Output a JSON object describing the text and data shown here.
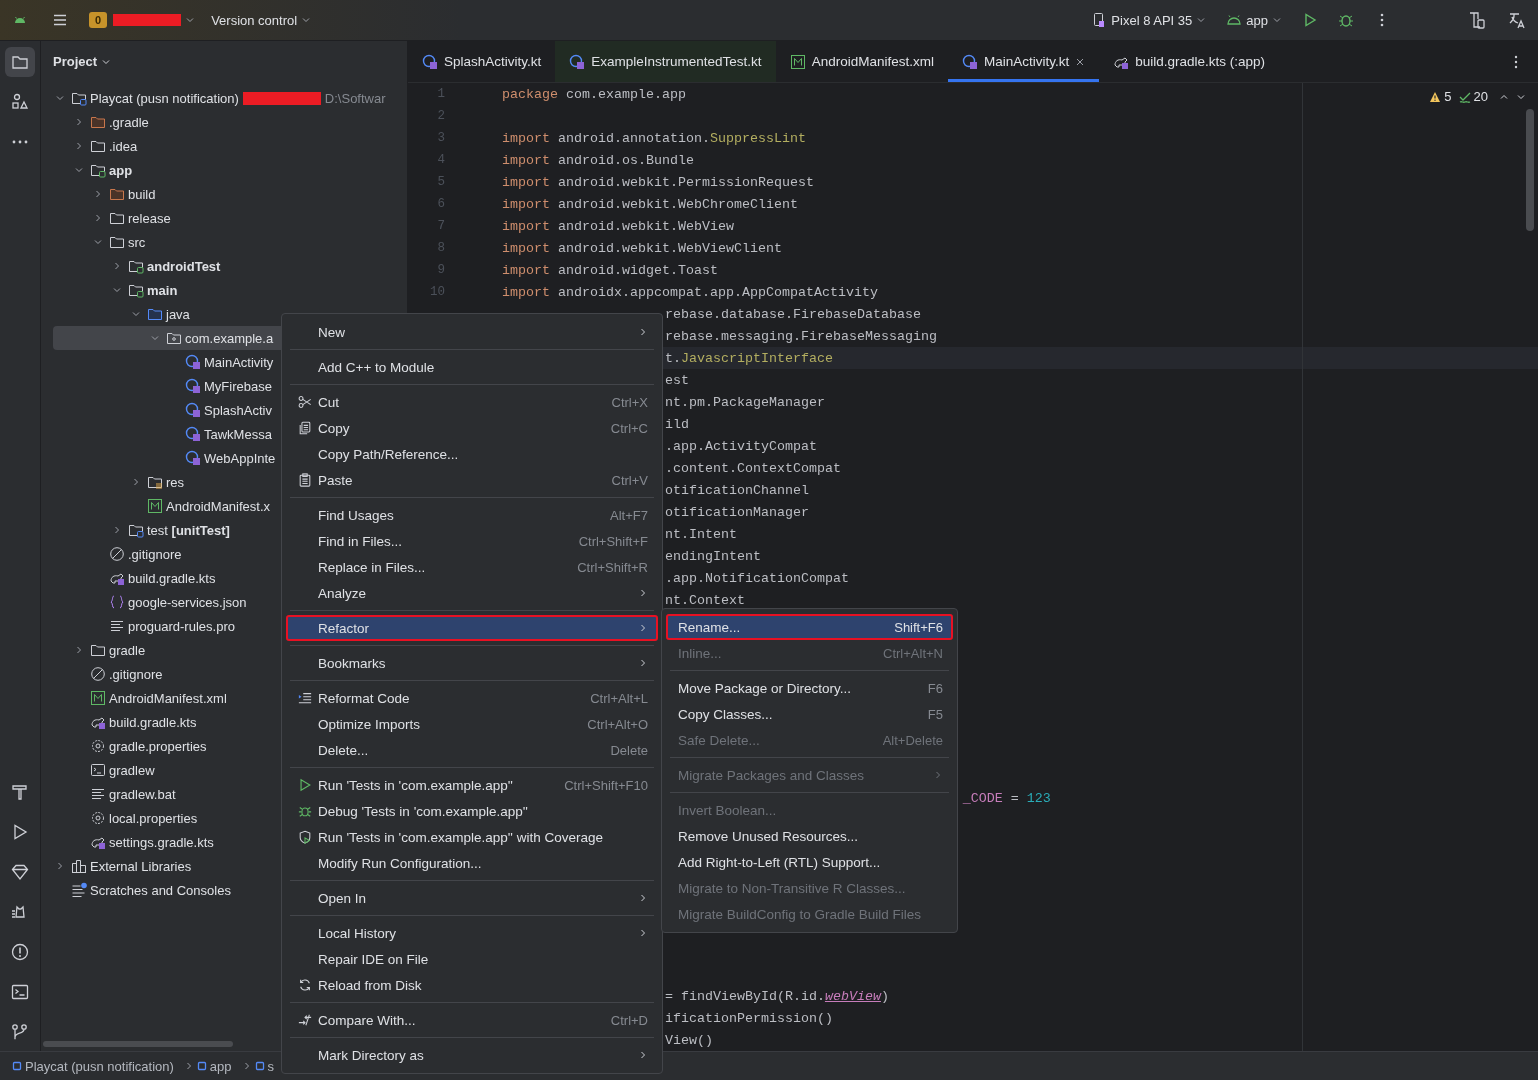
{
  "top_bar": {
    "project_badge": "0",
    "project_redacted": true,
    "vcs": "Version control",
    "device": "Pixel 8 API 35",
    "run_config": "app"
  },
  "left_toolbar": [
    {
      "kind": "project",
      "selected": true
    },
    {
      "kind": "structure",
      "selected": false
    },
    {
      "kind": "more",
      "selected": false
    }
  ],
  "project_panel": {
    "title": "Project"
  },
  "tree": {
    "items": [
      {
        "name": "Playcat (pusn notification)",
        "kind": "project",
        "redacted": true,
        "path": "D:\\Softwar",
        "expanded": true,
        "selected": false,
        "children": [
          {
            "name": ".gradle",
            "kind": "folder-excluded",
            "expanded": false,
            "selected": false
          },
          {
            "name": ".idea",
            "kind": "folder",
            "expanded": false,
            "selected": false
          },
          {
            "name": "app",
            "kind": "module",
            "expanded": true,
            "selected": false,
            "children": [
              {
                "name": "build",
                "kind": "folder-excluded",
                "expanded": false,
                "selected": false
              },
              {
                "name": "release",
                "kind": "folder",
                "expanded": false,
                "selected": false
              },
              {
                "name": "src",
                "kind": "folder",
                "expanded": true,
                "selected": false,
                "children": [
                  {
                    "name": "androidTest",
                    "kind": "module",
                    "expanded": false,
                    "selected": false
                  },
                  {
                    "name": "main",
                    "kind": "module",
                    "expanded": true,
                    "selected": false,
                    "children": [
                      {
                        "name": "java",
                        "kind": "folder-source",
                        "expanded": true,
                        "selected": false,
                        "children": [
                          {
                            "name": "com.example.a",
                            "kind": "package",
                            "expanded": true,
                            "selected": true,
                            "children": [
                              {
                                "name": "MainActivity",
                                "kind": "kotlin",
                                "selected": false
                              },
                              {
                                "name": "MyFirebase",
                                "kind": "kotlin",
                                "selected": false
                              },
                              {
                                "name": "SplashActiv",
                                "kind": "kotlin",
                                "selected": false
                              },
                              {
                                "name": "TawkMessa",
                                "kind": "kotlin",
                                "selected": false
                              },
                              {
                                "name": "WebAppInte",
                                "kind": "kotlin",
                                "selected": false
                              }
                            ]
                          }
                        ]
                      },
                      {
                        "name": "res",
                        "kind": "folder-res",
                        "expanded": false,
                        "selected": false
                      },
                      {
                        "name": "AndroidManifest.x",
                        "kind": "manifest",
                        "selected": false
                      }
                    ]
                  },
                  {
                    "name": "test **[unitTest]**",
                    "kind": "test-root",
                    "expanded": false,
                    "selected": false
                  }
                ]
              },
              {
                "name": ".gitignore",
                "kind": "ignore",
                "selected": false
              },
              {
                "name": "build.gradle.kts",
                "kind": "gradle",
                "selected": false
              },
              {
                "name": "google-services.json",
                "kind": "json",
                "selected": false
              },
              {
                "name": "proguard-rules.pro",
                "kind": "text",
                "selected": false
              }
            ]
          },
          {
            "name": "gradle",
            "kind": "folder",
            "expanded": false,
            "selected": false
          },
          {
            "name": ".gitignore",
            "kind": "ignore",
            "selected": false
          },
          {
            "name": "AndroidManifest.xml",
            "kind": "manifest",
            "selected": false
          },
          {
            "name": "build.gradle.kts",
            "kind": "gradle",
            "selected": false
          },
          {
            "name": "gradle.properties",
            "kind": "settings",
            "selected": false
          },
          {
            "name": "gradlew",
            "kind": "terminal",
            "selected": false
          },
          {
            "name": "gradlew.bat",
            "kind": "text",
            "selected": false
          },
          {
            "name": "local.properties",
            "kind": "settings",
            "selected": false
          },
          {
            "name": "settings.gradle.kts",
            "kind": "gradle",
            "selected": false
          }
        ]
      },
      {
        "name": "External Libraries",
        "kind": "libraries",
        "expanded": false,
        "selected": false
      },
      {
        "name": "Scratches and Consoles",
        "kind": "scratches",
        "selected": false
      }
    ]
  },
  "tabs": [
    {
      "label": "SplashActivity.kt",
      "kind": "kotlin",
      "selected": false
    },
    {
      "label": "ExampleInstrumentedTest.kt",
      "kind": "kotlin-test",
      "selected": false
    },
    {
      "label": "AndroidManifest.xml",
      "kind": "manifest",
      "selected": false
    },
    {
      "label": "MainActivity.kt",
      "kind": "kotlin",
      "selected": true
    },
    {
      "label": "build.gradle.kts (:app)",
      "kind": "gradle",
      "selected": false
    }
  ],
  "inspections": {
    "warnings": "5",
    "checks": "20"
  },
  "code_lines": [
    {
      "kind": "full",
      "number": "1",
      "current": false,
      "parts": [
        {
          "kind": "keyword",
          "text": "package"
        },
        {
          "kind": "plain",
          "text": " com.example.app"
        }
      ]
    },
    {
      "kind": "full",
      "number": "2",
      "current": false
    },
    {
      "kind": "full",
      "number": "3",
      "current": false,
      "parts": [
        {
          "kind": "keyword",
          "text": "import"
        },
        {
          "kind": "plain",
          "text": " android.annotation."
        },
        {
          "kind": "annotation",
          "text": "SuppressLint"
        }
      ]
    },
    {
      "kind": "full",
      "number": "4",
      "current": false,
      "parts": [
        {
          "kind": "keyword",
          "text": "import"
        },
        {
          "kind": "plain",
          "text": " android.os.Bundle"
        }
      ]
    },
    {
      "kind": "full",
      "number": "5",
      "current": false,
      "parts": [
        {
          "kind": "keyword",
          "text": "import"
        },
        {
          "kind": "plain",
          "text": " android.webkit.PermissionRequest"
        }
      ]
    },
    {
      "kind": "full",
      "number": "6",
      "current": false,
      "parts": [
        {
          "kind": "keyword",
          "text": "import"
        },
        {
          "kind": "plain",
          "text": " android.webkit.WebChromeClient"
        }
      ]
    },
    {
      "kind": "full",
      "number": "7",
      "current": false,
      "parts": [
        {
          "kind": "keyword",
          "text": "import"
        },
        {
          "kind": "plain",
          "text": " android.webkit.WebView"
        }
      ]
    },
    {
      "kind": "full",
      "number": "8",
      "current": false,
      "parts": [
        {
          "kind": "keyword",
          "text": "import"
        },
        {
          "kind": "plain",
          "text": " android.webkit.WebViewClient"
        }
      ]
    },
    {
      "kind": "full",
      "number": "9",
      "current": false,
      "parts": [
        {
          "kind": "keyword",
          "text": "import"
        },
        {
          "kind": "plain",
          "text": " android.widget.Toast"
        }
      ]
    },
    {
      "kind": "full",
      "number": "10",
      "current": false,
      "parts": [
        {
          "kind": "keyword",
          "text": "import"
        },
        {
          "kind": "plain",
          "text": " androidx.appcompat.app.AppCompatActivity"
        }
      ]
    },
    {
      "kind": "after-menu",
      "current": false,
      "parts": [
        {
          "kind": "plain",
          "text": "rebase.database.FirebaseDatabase"
        }
      ]
    },
    {
      "kind": "after-menu",
      "current": false,
      "parts": [
        {
          "kind": "plain",
          "text": "rebase.messaging.FirebaseMessaging"
        }
      ]
    },
    {
      "kind": "after-menu",
      "current": true,
      "parts": [
        {
          "kind": "plain",
          "text": "t."
        },
        {
          "kind": "annotation",
          "text": "JavascriptInterface"
        }
      ]
    },
    {
      "kind": "after-menu",
      "current": false,
      "parts": [
        {
          "kind": "plain",
          "text": "est"
        }
      ]
    },
    {
      "kind": "after-menu",
      "current": false,
      "parts": [
        {
          "kind": "plain",
          "text": "nt.pm.PackageManager"
        }
      ]
    },
    {
      "kind": "after-menu",
      "current": false,
      "parts": [
        {
          "kind": "plain",
          "text": "ild"
        }
      ]
    },
    {
      "kind": "after-menu",
      "current": false,
      "parts": [
        {
          "kind": "plain",
          "text": ".app.ActivityCompat"
        }
      ]
    },
    {
      "kind": "after-menu",
      "current": false,
      "parts": [
        {
          "kind": "plain",
          "text": ".content.ContextCompat"
        }
      ]
    },
    {
      "kind": "after-menu",
      "current": false,
      "parts": [
        {
          "kind": "plain",
          "text": "otificationChannel"
        }
      ]
    },
    {
      "kind": "after-menu",
      "current": false,
      "parts": [
        {
          "kind": "plain",
          "text": "otificationManager"
        }
      ]
    },
    {
      "kind": "after-menu",
      "current": false,
      "parts": [
        {
          "kind": "plain",
          "text": "nt.Intent"
        }
      ]
    },
    {
      "kind": "after-menu",
      "current": false,
      "parts": [
        {
          "kind": "plain",
          "text": "endingIntent"
        }
      ]
    },
    {
      "kind": "after-menu",
      "current": false,
      "parts": [
        {
          "kind": "plain",
          "text": ".app.NotificationCompat"
        }
      ]
    },
    {
      "kind": "after-menu",
      "current": false,
      "parts": [
        {
          "kind": "plain",
          "text": "nt.Context"
        }
      ]
    },
    {
      "kind": "covered",
      "current": false
    },
    {
      "kind": "covered",
      "current": false
    },
    {
      "kind": "covered",
      "current": false
    },
    {
      "kind": "covered",
      "current": false
    },
    {
      "kind": "covered",
      "current": false
    },
    {
      "kind": "covered",
      "current": false
    },
    {
      "kind": "covered",
      "current": false
    },
    {
      "kind": "covered",
      "current": false
    },
    {
      "kind": "after-submenu",
      "current": false,
      "parts": [
        {
          "kind": "field",
          "text": "_CODE"
        },
        {
          "kind": "plain",
          "text": " = "
        },
        {
          "kind": "number",
          "text": "123"
        }
      ]
    },
    {
      "kind": "covered",
      "current": false
    },
    {
      "kind": "covered",
      "current": false
    },
    {
      "kind": "covered",
      "current": false
    },
    {
      "kind": "covered",
      "current": false
    },
    {
      "kind": "covered",
      "current": false
    },
    {
      "kind": "covered",
      "current": false
    },
    {
      "kind": "covered",
      "current": false
    },
    {
      "kind": "covered",
      "current": false
    },
    {
      "kind": "after-menu",
      "current": false,
      "parts": [
        {
          "kind": "plain",
          "text": "= findViewById(R.id."
        },
        {
          "kind": "link",
          "text": "webView"
        },
        {
          "kind": "plain",
          "text": ")"
        }
      ]
    },
    {
      "kind": "after-menu",
      "current": false,
      "parts": [
        {
          "kind": "plain",
          "text": "ificationPermission()"
        }
      ]
    },
    {
      "kind": "after-menu",
      "current": false,
      "parts": [
        {
          "kind": "plain",
          "text": "View()"
        }
      ]
    }
  ],
  "context_menu": {
    "groups": [
      [
        {
          "label": "New",
          "kind": "plain",
          "submenu": true,
          "selected": false
        }
      ],
      [
        {
          "label": "Add C++ to Module",
          "kind": "plain",
          "selected": false
        }
      ],
      [
        {
          "label": "Cut",
          "shortcut": "Ctrl+X",
          "kind": "cut",
          "selected": false
        },
        {
          "label": "Copy",
          "shortcut": "Ctrl+C",
          "kind": "copy",
          "selected": false
        },
        {
          "label": "Copy Path/Reference...",
          "kind": "plain",
          "selected": false
        },
        {
          "label": "Paste",
          "shortcut": "Ctrl+V",
          "kind": "paste",
          "selected": false
        }
      ],
      [
        {
          "label": "Find Usages",
          "shortcut": "Alt+F7",
          "kind": "plain",
          "selected": false
        },
        {
          "label": "Find in Files...",
          "shortcut": "Ctrl+Shift+F",
          "kind": "plain",
          "selected": false
        },
        {
          "label": "Replace in Files...",
          "shortcut": "Ctrl+Shift+R",
          "kind": "plain",
          "selected": false
        },
        {
          "label": "Analyze",
          "kind": "plain",
          "submenu": true,
          "selected": false
        }
      ],
      [
        {
          "label": "Refactor",
          "kind": "plain",
          "submenu": true,
          "selected": true,
          "outlined": true
        }
      ],
      [
        {
          "label": "Bookmarks",
          "kind": "plain",
          "submenu": true,
          "selected": false
        }
      ],
      [
        {
          "label": "Reformat Code",
          "shortcut": "Ctrl+Alt+L",
          "kind": "reformat",
          "selected": false
        },
        {
          "label": "Optimize Imports",
          "shortcut": "Ctrl+Alt+O",
          "kind": "plain",
          "selected": false
        },
        {
          "label": "Delete...",
          "shortcut": "Delete",
          "kind": "plain",
          "selected": false
        }
      ],
      [
        {
          "label": "Run 'Tests in 'com.example.app''",
          "shortcut": "Ctrl+Shift+F10",
          "kind": "run",
          "selected": false
        },
        {
          "label": "Debug 'Tests in 'com.example.app''",
          "kind": "debug",
          "selected": false
        },
        {
          "label": "Run 'Tests in 'com.example.app'' with Coverage",
          "kind": "coverage",
          "selected": false
        },
        {
          "label": "Modify Run Configuration...",
          "kind": "plain",
          "selected": false
        }
      ],
      [
        {
          "label": "Open In",
          "kind": "plain",
          "submenu": true,
          "selected": false
        }
      ],
      [
        {
          "label": "Local History",
          "kind": "plain",
          "submenu": true,
          "selected": false
        },
        {
          "label": "Repair IDE on File",
          "kind": "plain",
          "selected": false
        },
        {
          "label": "Reload from Disk",
          "kind": "reload",
          "selected": false
        }
      ],
      [
        {
          "label": "Compare With...",
          "shortcut": "Ctrl+D",
          "kind": "compare",
          "selected": false
        }
      ],
      [
        {
          "label": "Mark Directory as",
          "kind": "plain",
          "submenu": true,
          "selected": false
        }
      ]
    ]
  },
  "refactor_submenu": {
    "groups": [
      [
        {
          "label": "Rename...",
          "shortcut": "Shift+F6",
          "selected": true,
          "outlined": true,
          "disabled": false
        },
        {
          "label": "Inline...",
          "shortcut": "Ctrl+Alt+N",
          "selected": false,
          "disabled": true
        }
      ],
      [
        {
          "label": "Move Package or Directory...",
          "shortcut": "F6",
          "selected": false,
          "disabled": false
        },
        {
          "label": "Copy Classes...",
          "shortcut": "F5",
          "selected": false,
          "disabled": false
        },
        {
          "label": "Safe Delete...",
          "shortcut": "Alt+Delete",
          "selected": false,
          "disabled": true
        }
      ],
      [
        {
          "label": "Migrate Packages and Classes",
          "submenu": true,
          "selected": false,
          "disabled": true
        }
      ],
      [
        {
          "label": "Invert Boolean...",
          "selected": false,
          "disabled": true
        },
        {
          "label": "Remove Unused Resources...",
          "selected": false,
          "disabled": false
        },
        {
          "label": "Add Right-to-Left (RTL) Support...",
          "selected": false,
          "disabled": false
        },
        {
          "label": "Migrate to Non-Transitive R Classes...",
          "selected": false,
          "disabled": true
        },
        {
          "label": "Migrate BuildConfig to Gradle Build Files",
          "selected": false,
          "disabled": true
        }
      ]
    ]
  },
  "breadcrumbs": [
    "Playcat (pusn notification)",
    "app",
    "s"
  ]
}
